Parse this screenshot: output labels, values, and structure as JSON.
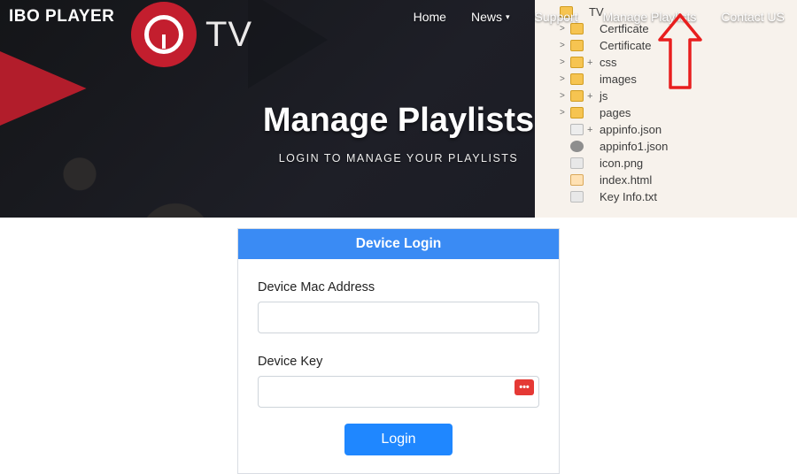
{
  "brand": "IBO PLAYER",
  "nav": {
    "home": "Home",
    "news": "News",
    "support": "Support",
    "manage": "Manage Playlists",
    "contact": "Contact US"
  },
  "logo_tv": "TV",
  "hero": {
    "title": "Manage Playlists",
    "subtitle": "LOGIN TO MANAGE YOUR PLAYLISTS"
  },
  "tree": {
    "items": [
      {
        "level": 1,
        "tw": "",
        "icon": "folder-open",
        "plus": "",
        "name": "TV"
      },
      {
        "level": 2,
        "tw": ">",
        "icon": "folder",
        "plus": "",
        "name": "Certficate"
      },
      {
        "level": 2,
        "tw": ">",
        "icon": "folder",
        "plus": "",
        "name": "Certificate"
      },
      {
        "level": 2,
        "tw": ">",
        "icon": "folder",
        "plus": "+",
        "name": "css"
      },
      {
        "level": 2,
        "tw": ">",
        "icon": "folder",
        "plus": "",
        "name": "images"
      },
      {
        "level": 2,
        "tw": ">",
        "icon": "folder",
        "plus": "+",
        "name": "js"
      },
      {
        "level": 2,
        "tw": ">",
        "icon": "folder",
        "plus": "",
        "name": "pages"
      },
      {
        "level": 2,
        "tw": "",
        "icon": "json",
        "plus": "+",
        "name": "appinfo.json"
      },
      {
        "level": 2,
        "tw": "",
        "icon": "disk",
        "plus": "",
        "name": "appinfo1.json"
      },
      {
        "level": 2,
        "tw": "",
        "icon": "img",
        "plus": "",
        "name": "icon.png"
      },
      {
        "level": 2,
        "tw": "",
        "icon": "html",
        "plus": "",
        "name": "index.html"
      },
      {
        "level": 2,
        "tw": "",
        "icon": "txt",
        "plus": "",
        "name": "Key Info.txt"
      }
    ]
  },
  "card": {
    "header": "Device Login",
    "mac_label": "Device Mac Address",
    "mac_value": "",
    "key_label": "Device Key",
    "key_value": "",
    "pw_badge": "•••",
    "login": "Login"
  },
  "colors": {
    "accent": "#3a8bf4",
    "primary_btn": "#1f87ff",
    "arrow": "#e81e1e"
  }
}
